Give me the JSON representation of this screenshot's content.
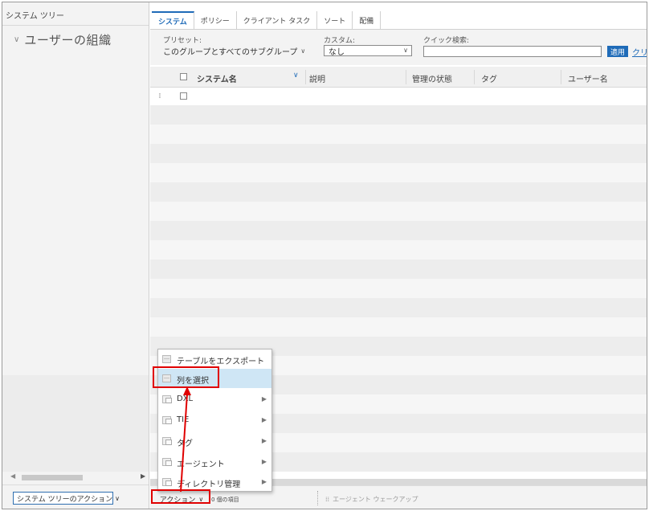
{
  "left_pane": {
    "title": "システム ツリー",
    "tree_root": "ユーザーの組織",
    "tree_action_button": "システム ツリーのアクション"
  },
  "tabs": [
    "システム",
    "ポリシー",
    "クライアント タスク",
    "ソート",
    "配備"
  ],
  "filter": {
    "preset_label": "プリセット:",
    "preset_value": "このグループとすべてのサブグループ",
    "custom_label": "カスタム:",
    "custom_value": "なし",
    "quick_search_label": "クイック検索:",
    "quick_search_value": "",
    "apply_label": "適用",
    "clear_label": "クリ"
  },
  "table": {
    "columns": [
      "システム名",
      "説明",
      "管理の状態",
      "タグ",
      "ユーザー名"
    ]
  },
  "bottom": {
    "action_label": "アクション",
    "items_count": "0 個の項目",
    "wakeup_label": "エージェント ウェークアップ"
  },
  "context_menu": {
    "items": [
      {
        "label": "テーブルをエクスポート",
        "icon": "table-icon",
        "submenu": false
      },
      {
        "label": "列を選択",
        "icon": "table-icon",
        "submenu": false,
        "selected": true
      },
      {
        "label": "DXL",
        "icon": "folder-icon",
        "submenu": true
      },
      {
        "label": "TIE",
        "icon": "folder-icon",
        "submenu": true
      },
      {
        "label": "タグ",
        "icon": "folder-icon",
        "submenu": true
      },
      {
        "label": "エージェント",
        "icon": "folder-icon",
        "submenu": true
      },
      {
        "label": "ディレクトリ管理",
        "icon": "folder-icon",
        "submenu": true
      }
    ]
  },
  "colors": {
    "accent": "#1f6bb8",
    "highlight": "#e00000",
    "menu_selected": "#cfe6f5"
  }
}
